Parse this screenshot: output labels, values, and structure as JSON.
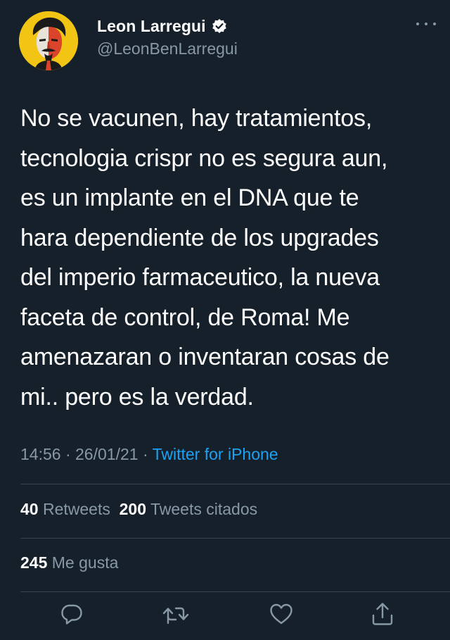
{
  "author": {
    "display_name": "Leon Larregui",
    "handle": "@LeonBenLarregui",
    "verified": true
  },
  "tweet": {
    "lines": [
      "No se vacunen, hay tratamientos,",
      "tecnologia crispr no es segura aun,",
      "es un implante en el DNA que te",
      "hara dependiente de los upgrades",
      "del imperio farmaceutico, la nueva",
      "faceta de control, de Roma! Me",
      "amenazaran o inventaran cosas de",
      "mi.. pero es la verdad."
    ],
    "time": "14:56",
    "separator": "·",
    "date": "26/01/21",
    "source": "Twitter for iPhone"
  },
  "stats": {
    "retweets_count": "40",
    "retweets_label": "Retweets",
    "quotes_count": "200",
    "quotes_label": "Tweets citados",
    "likes_count": "245",
    "likes_label": "Me gusta"
  },
  "actions": [
    {
      "icon": "reply-icon"
    },
    {
      "icon": "retweet-icon"
    },
    {
      "icon": "like-icon"
    },
    {
      "icon": "share-icon"
    }
  ],
  "colors": {
    "background": "#15202b",
    "text": "#ffffff",
    "secondary": "#8899a6",
    "link": "#1da1f2",
    "divider": "#38444d",
    "avatar_bg": "#f2c514"
  }
}
